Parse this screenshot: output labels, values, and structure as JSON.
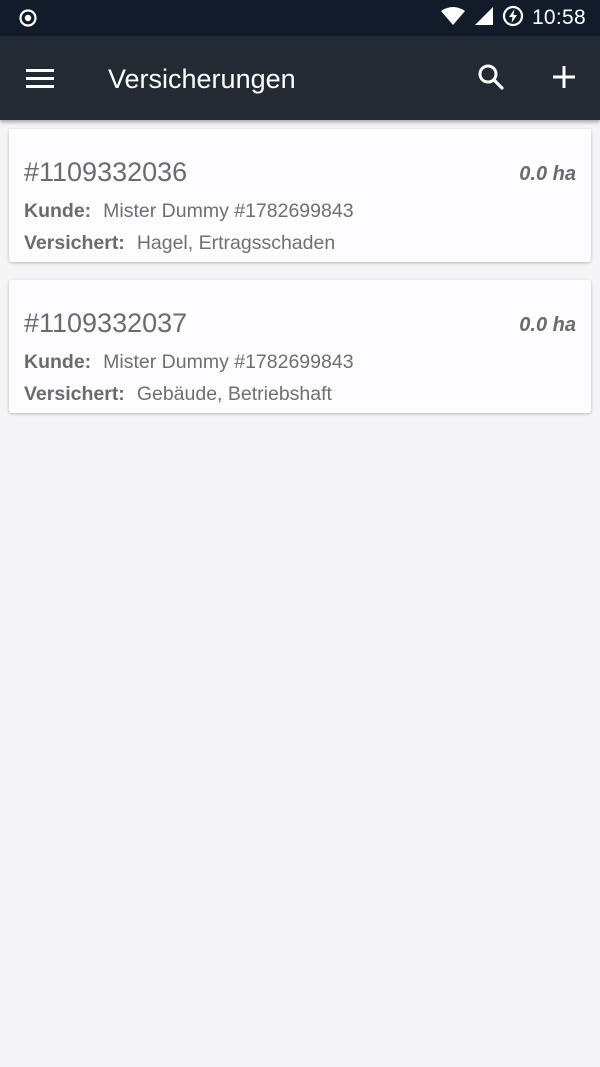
{
  "statusbar": {
    "time": "10:58",
    "icons": [
      "radio-icon",
      "wifi-icon",
      "signal-icon",
      "battery-charging-icon"
    ]
  },
  "appbar": {
    "title": "Versicherungen",
    "menu_icon": "hamburger-menu-icon",
    "search_icon": "search-icon",
    "add_icon": "add-icon"
  },
  "labels": {
    "customer": "Kunde:",
    "insured": "Versichert:"
  },
  "policies": [
    {
      "id": "#1109332036",
      "area": "0.0 ha",
      "customer": "Mister Dummy #1782699843",
      "insured": "Hagel, Ertragsschaden"
    },
    {
      "id": "#1109332037",
      "area": "0.0 ha",
      "customer": "Mister Dummy #1782699843",
      "insured": "Gebäude, Betriebshaft"
    }
  ],
  "colors": {
    "statusbar": "#121b29",
    "appbar": "#232a34",
    "background": "#f5f4f7",
    "card": "#fdfcfe",
    "text": "#6a6a70"
  }
}
